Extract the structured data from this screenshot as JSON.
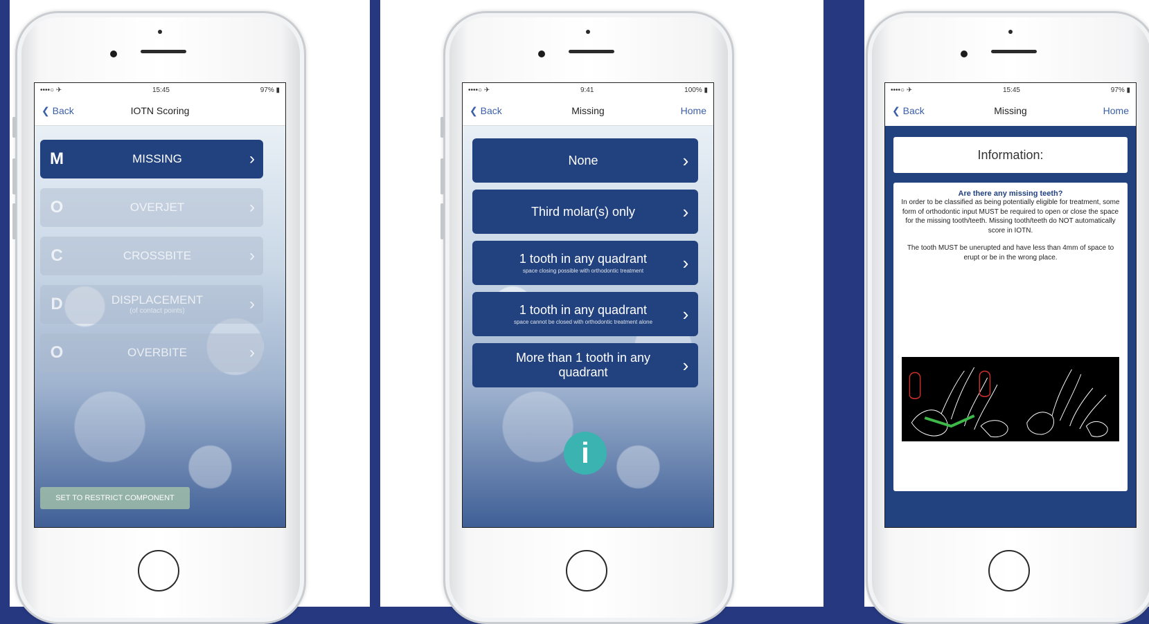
{
  "screens": [
    {
      "statusbar": {
        "left": "••••○ ✈",
        "center": "15:45",
        "right": "97% ▮"
      },
      "navbar": {
        "back": "Back",
        "title": "IOTN Scoring",
        "right": ""
      },
      "items": [
        {
          "letter": "M",
          "label": "MISSING",
          "sub": "",
          "state": "active"
        },
        {
          "letter": "O",
          "label": "OVERJET",
          "sub": "",
          "state": "disabled"
        },
        {
          "letter": "C",
          "label": "CROSSBITE",
          "sub": "",
          "state": "disabled"
        },
        {
          "letter": "D",
          "label": "DISPLACEMENT",
          "sub": "(of contact points)",
          "state": "disabled"
        },
        {
          "letter": "O",
          "label": "OVERBITE",
          "sub": "",
          "state": "disabled"
        }
      ],
      "restrict_button": "SET TO RESTRICT COMPONENT"
    },
    {
      "statusbar": {
        "left": "••••○ ✈",
        "center": "9:41",
        "right": "100% ▮"
      },
      "navbar": {
        "back": "Back",
        "title": "Missing",
        "right": "Home"
      },
      "options": [
        {
          "label": "None",
          "sub": ""
        },
        {
          "label": "Third molar(s) only",
          "sub": ""
        },
        {
          "label": "1 tooth in any quadrant",
          "sub": "space closing possible with orthodontic treatment"
        },
        {
          "label": "1 tooth in any quadrant",
          "sub": "space cannot be closed with orthodontic treatment alone"
        },
        {
          "label": "More than 1 tooth in any quadrant",
          "sub": ""
        }
      ],
      "info_button": "i"
    },
    {
      "statusbar": {
        "left": "••••○ ✈",
        "center": "15:45",
        "right": "97% ▮"
      },
      "navbar": {
        "back": "Back",
        "title": "Missing",
        "right": "Home"
      },
      "info_title": "Information:",
      "question": "Are there any missing teeth?",
      "paragraph1": "In order to be classified as being potentially eligible for treatment, some form of orthodontic input MUST be required to open or close the space for the missing tooth/teeth. Missing tooth/teeth do NOT automatically score in IOTN.",
      "paragraph2": "The tooth MUST be unerupted and have less than 4mm of space to erupt or be in the wrong place."
    }
  ],
  "colors": {
    "accent": "#22427f",
    "page_bg": "#26387f",
    "info": "#3bb3b0",
    "link": "#3a5fa8"
  }
}
